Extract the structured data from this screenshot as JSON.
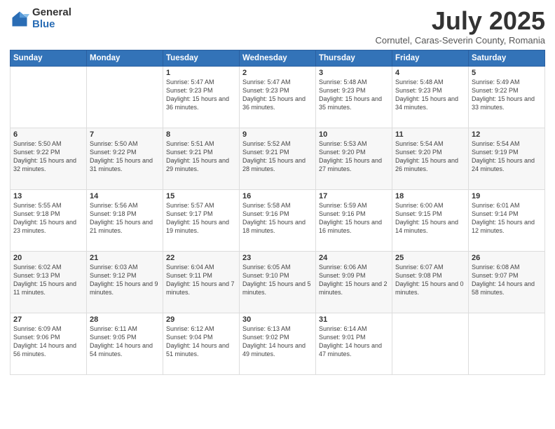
{
  "logo": {
    "general": "General",
    "blue": "Blue"
  },
  "title": "July 2025",
  "subtitle": "Cornutel, Caras-Severin County, Romania",
  "weekdays": [
    "Sunday",
    "Monday",
    "Tuesday",
    "Wednesday",
    "Thursday",
    "Friday",
    "Saturday"
  ],
  "weeks": [
    [
      {
        "day": "",
        "sunrise": "",
        "sunset": "",
        "daylight": ""
      },
      {
        "day": "",
        "sunrise": "",
        "sunset": "",
        "daylight": ""
      },
      {
        "day": "1",
        "sunrise": "Sunrise: 5:47 AM",
        "sunset": "Sunset: 9:23 PM",
        "daylight": "Daylight: 15 hours and 36 minutes."
      },
      {
        "day": "2",
        "sunrise": "Sunrise: 5:47 AM",
        "sunset": "Sunset: 9:23 PM",
        "daylight": "Daylight: 15 hours and 36 minutes."
      },
      {
        "day": "3",
        "sunrise": "Sunrise: 5:48 AM",
        "sunset": "Sunset: 9:23 PM",
        "daylight": "Daylight: 15 hours and 35 minutes."
      },
      {
        "day": "4",
        "sunrise": "Sunrise: 5:48 AM",
        "sunset": "Sunset: 9:23 PM",
        "daylight": "Daylight: 15 hours and 34 minutes."
      },
      {
        "day": "5",
        "sunrise": "Sunrise: 5:49 AM",
        "sunset": "Sunset: 9:22 PM",
        "daylight": "Daylight: 15 hours and 33 minutes."
      }
    ],
    [
      {
        "day": "6",
        "sunrise": "Sunrise: 5:50 AM",
        "sunset": "Sunset: 9:22 PM",
        "daylight": "Daylight: 15 hours and 32 minutes."
      },
      {
        "day": "7",
        "sunrise": "Sunrise: 5:50 AM",
        "sunset": "Sunset: 9:22 PM",
        "daylight": "Daylight: 15 hours and 31 minutes."
      },
      {
        "day": "8",
        "sunrise": "Sunrise: 5:51 AM",
        "sunset": "Sunset: 9:21 PM",
        "daylight": "Daylight: 15 hours and 29 minutes."
      },
      {
        "day": "9",
        "sunrise": "Sunrise: 5:52 AM",
        "sunset": "Sunset: 9:21 PM",
        "daylight": "Daylight: 15 hours and 28 minutes."
      },
      {
        "day": "10",
        "sunrise": "Sunrise: 5:53 AM",
        "sunset": "Sunset: 9:20 PM",
        "daylight": "Daylight: 15 hours and 27 minutes."
      },
      {
        "day": "11",
        "sunrise": "Sunrise: 5:54 AM",
        "sunset": "Sunset: 9:20 PM",
        "daylight": "Daylight: 15 hours and 26 minutes."
      },
      {
        "day": "12",
        "sunrise": "Sunrise: 5:54 AM",
        "sunset": "Sunset: 9:19 PM",
        "daylight": "Daylight: 15 hours and 24 minutes."
      }
    ],
    [
      {
        "day": "13",
        "sunrise": "Sunrise: 5:55 AM",
        "sunset": "Sunset: 9:18 PM",
        "daylight": "Daylight: 15 hours and 23 minutes."
      },
      {
        "day": "14",
        "sunrise": "Sunrise: 5:56 AM",
        "sunset": "Sunset: 9:18 PM",
        "daylight": "Daylight: 15 hours and 21 minutes."
      },
      {
        "day": "15",
        "sunrise": "Sunrise: 5:57 AM",
        "sunset": "Sunset: 9:17 PM",
        "daylight": "Daylight: 15 hours and 19 minutes."
      },
      {
        "day": "16",
        "sunrise": "Sunrise: 5:58 AM",
        "sunset": "Sunset: 9:16 PM",
        "daylight": "Daylight: 15 hours and 18 minutes."
      },
      {
        "day": "17",
        "sunrise": "Sunrise: 5:59 AM",
        "sunset": "Sunset: 9:16 PM",
        "daylight": "Daylight: 15 hours and 16 minutes."
      },
      {
        "day": "18",
        "sunrise": "Sunrise: 6:00 AM",
        "sunset": "Sunset: 9:15 PM",
        "daylight": "Daylight: 15 hours and 14 minutes."
      },
      {
        "day": "19",
        "sunrise": "Sunrise: 6:01 AM",
        "sunset": "Sunset: 9:14 PM",
        "daylight": "Daylight: 15 hours and 12 minutes."
      }
    ],
    [
      {
        "day": "20",
        "sunrise": "Sunrise: 6:02 AM",
        "sunset": "Sunset: 9:13 PM",
        "daylight": "Daylight: 15 hours and 11 minutes."
      },
      {
        "day": "21",
        "sunrise": "Sunrise: 6:03 AM",
        "sunset": "Sunset: 9:12 PM",
        "daylight": "Daylight: 15 hours and 9 minutes."
      },
      {
        "day": "22",
        "sunrise": "Sunrise: 6:04 AM",
        "sunset": "Sunset: 9:11 PM",
        "daylight": "Daylight: 15 hours and 7 minutes."
      },
      {
        "day": "23",
        "sunrise": "Sunrise: 6:05 AM",
        "sunset": "Sunset: 9:10 PM",
        "daylight": "Daylight: 15 hours and 5 minutes."
      },
      {
        "day": "24",
        "sunrise": "Sunrise: 6:06 AM",
        "sunset": "Sunset: 9:09 PM",
        "daylight": "Daylight: 15 hours and 2 minutes."
      },
      {
        "day": "25",
        "sunrise": "Sunrise: 6:07 AM",
        "sunset": "Sunset: 9:08 PM",
        "daylight": "Daylight: 15 hours and 0 minutes."
      },
      {
        "day": "26",
        "sunrise": "Sunrise: 6:08 AM",
        "sunset": "Sunset: 9:07 PM",
        "daylight": "Daylight: 14 hours and 58 minutes."
      }
    ],
    [
      {
        "day": "27",
        "sunrise": "Sunrise: 6:09 AM",
        "sunset": "Sunset: 9:06 PM",
        "daylight": "Daylight: 14 hours and 56 minutes."
      },
      {
        "day": "28",
        "sunrise": "Sunrise: 6:11 AM",
        "sunset": "Sunset: 9:05 PM",
        "daylight": "Daylight: 14 hours and 54 minutes."
      },
      {
        "day": "29",
        "sunrise": "Sunrise: 6:12 AM",
        "sunset": "Sunset: 9:04 PM",
        "daylight": "Daylight: 14 hours and 51 minutes."
      },
      {
        "day": "30",
        "sunrise": "Sunrise: 6:13 AM",
        "sunset": "Sunset: 9:02 PM",
        "daylight": "Daylight: 14 hours and 49 minutes."
      },
      {
        "day": "31",
        "sunrise": "Sunrise: 6:14 AM",
        "sunset": "Sunset: 9:01 PM",
        "daylight": "Daylight: 14 hours and 47 minutes."
      },
      {
        "day": "",
        "sunrise": "",
        "sunset": "",
        "daylight": ""
      },
      {
        "day": "",
        "sunrise": "",
        "sunset": "",
        "daylight": ""
      }
    ]
  ]
}
